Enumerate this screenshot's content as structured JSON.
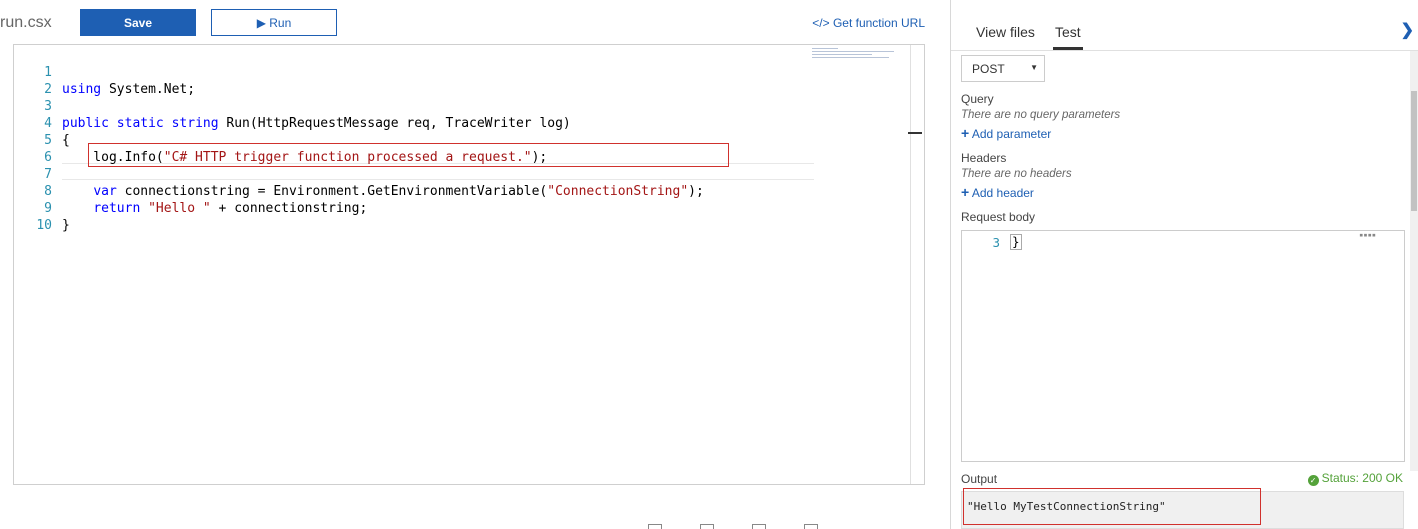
{
  "header": {
    "filename": "run.csx",
    "save_label": "Save",
    "run_label": "▶ Run",
    "get_url_label": "</> Get function URL"
  },
  "editor": {
    "lines": [
      {
        "n": "1",
        "code": "using System.Net;"
      },
      {
        "n": "2",
        "code": ""
      },
      {
        "n": "3",
        "code": "public static string Run(HttpRequestMessage req, TraceWriter log)"
      },
      {
        "n": "4",
        "code": "{"
      },
      {
        "n": "5",
        "code": "    log.Info(\"C# HTTP trigger function processed a request.\");"
      },
      {
        "n": "6",
        "code": ""
      },
      {
        "n": "7",
        "code": "    var connectionstring = Environment.GetEnvironmentVariable(\"ConnectionString\");"
      },
      {
        "n": "8",
        "code": "    return \"Hello \" + connectionstring;"
      },
      {
        "n": "9",
        "code": "}"
      },
      {
        "n": "10",
        "code": ""
      }
    ]
  },
  "tabs": {
    "view_files": "View files",
    "test": "Test",
    "collapse_icon": "chevron-right-icon"
  },
  "test": {
    "method": "POST",
    "query_label": "Query",
    "query_empty": "There are no query parameters",
    "add_parameter": "Add parameter",
    "headers_label": "Headers",
    "headers_empty": "There are no headers",
    "add_header": "Add header",
    "body_label": "Request body",
    "body_line_no": "3",
    "body_code": "}",
    "output_label": "Output",
    "status": "Status: 200 OK",
    "output_text": "\"Hello MyTestConnectionString\""
  },
  "colors": {
    "accent": "#1e5fb3",
    "highlight": "#d0312d",
    "status_ok": "#54a23a"
  }
}
